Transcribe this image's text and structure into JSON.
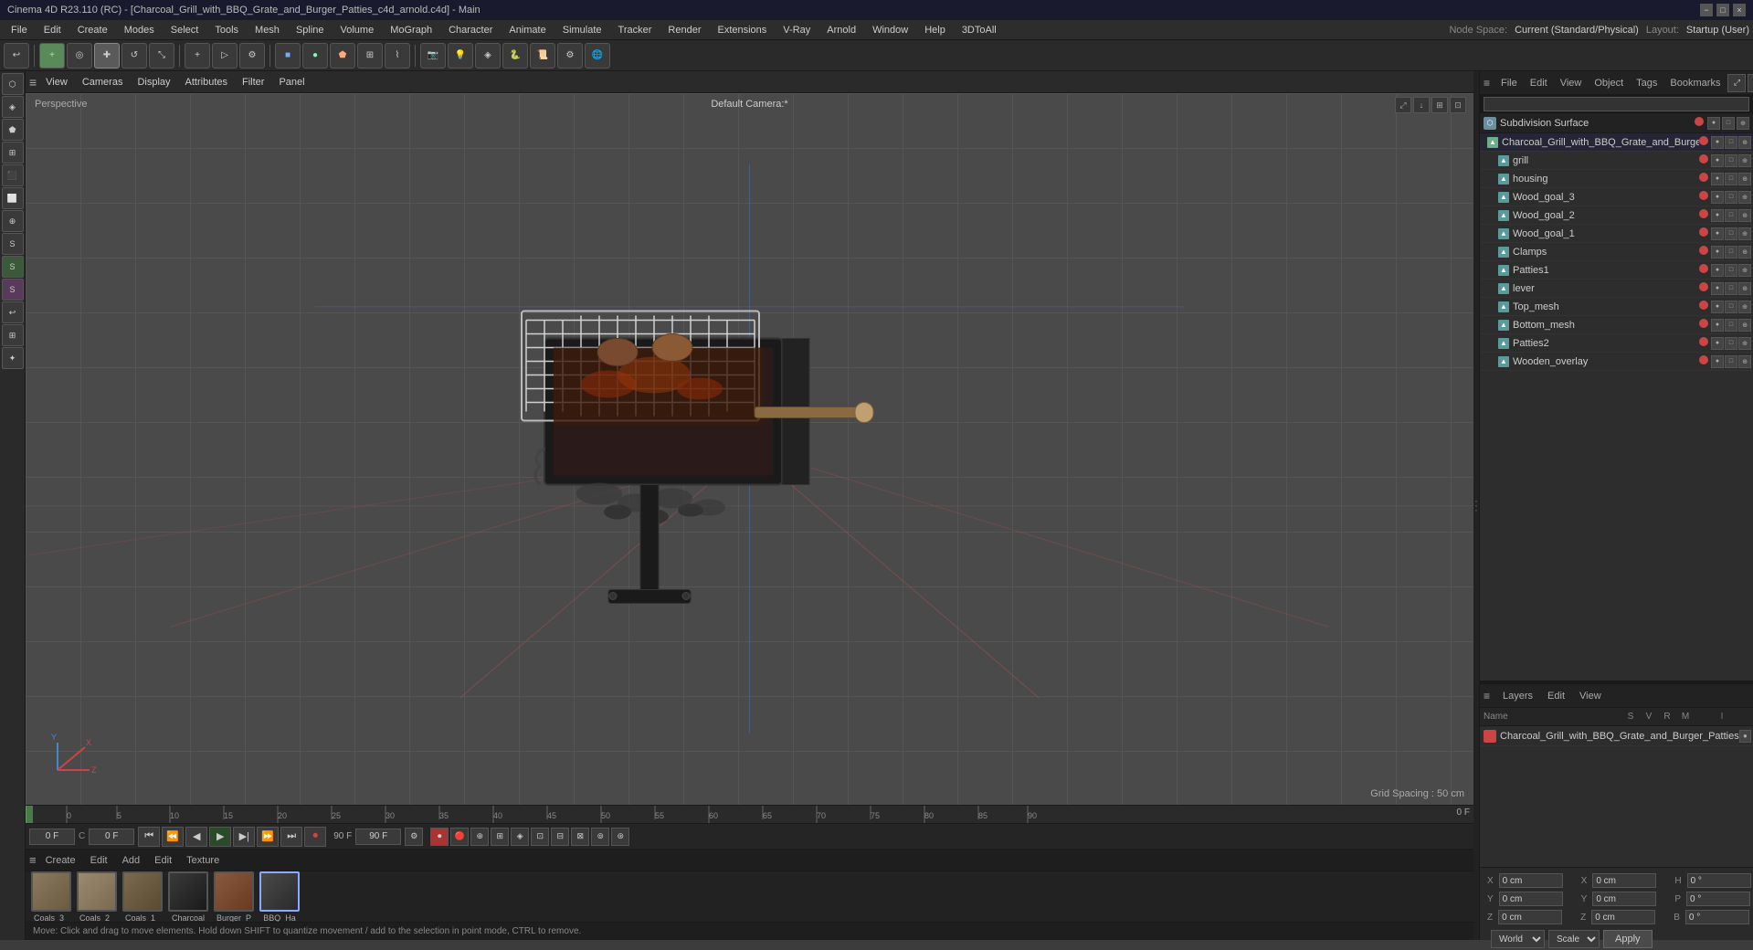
{
  "title_bar": {
    "text": "Cinema 4D R23.110 (RC) - [Charcoal_Grill_with_BBQ_Grate_and_Burger_Patties_c4d_arnold.c4d] - Main",
    "minimize": "−",
    "maximize": "□",
    "close": "×"
  },
  "menu_bar": {
    "items": [
      "File",
      "Edit",
      "Create",
      "Modes",
      "Select",
      "Tools",
      "Mesh",
      "Spline",
      "Volume",
      "MoGraph",
      "Character",
      "Animate",
      "Simulate",
      "Tracker",
      "Render",
      "Extensions",
      "V-Ray",
      "Arnold",
      "Window",
      "Help",
      "3DToAll"
    ],
    "node_space_label": "Node Space:",
    "node_space_value": "Current (Standard/Physical)",
    "layout_label": "Layout:",
    "layout_value": "Startup (User)"
  },
  "viewport": {
    "label": "Perspective",
    "camera": "Default Camera:*",
    "grid_spacing": "Grid Spacing : 50 cm",
    "menus": [
      "View",
      "Cameras",
      "Display",
      "Attributes",
      "Filter",
      "Panel"
    ]
  },
  "object_manager": {
    "menus": [
      "File",
      "Edit",
      "View",
      "Object",
      "Tags",
      "Bookmarks"
    ],
    "subdivision_surface": "Subdivision Surface",
    "root_object": "Charcoal_Grill_with_BBQ_Grate_and_Burger_Patties",
    "items": [
      {
        "name": "grill",
        "indent": 1,
        "color": "cyan"
      },
      {
        "name": "housing",
        "indent": 1,
        "color": "cyan"
      },
      {
        "name": "Wood_goal_3",
        "indent": 1,
        "color": "cyan"
      },
      {
        "name": "Wood_goal_2",
        "indent": 1,
        "color": "cyan"
      },
      {
        "name": "Wood_goal_1",
        "indent": 1,
        "color": "cyan"
      },
      {
        "name": "Clamps",
        "indent": 1,
        "color": "cyan"
      },
      {
        "name": "Patties1",
        "indent": 1,
        "color": "cyan"
      },
      {
        "name": "lever",
        "indent": 1,
        "color": "cyan"
      },
      {
        "name": "Top_mesh",
        "indent": 1,
        "color": "cyan"
      },
      {
        "name": "Bottom_mesh",
        "indent": 1,
        "color": "cyan"
      },
      {
        "name": "Patties2",
        "indent": 1,
        "color": "cyan"
      },
      {
        "name": "Wooden_overlay",
        "indent": 1,
        "color": "cyan"
      }
    ]
  },
  "layers_panel": {
    "toolbar_menus": [
      "Layers",
      "Edit",
      "View"
    ],
    "columns": {
      "name": "Name",
      "s": "S",
      "v": "V",
      "r": "R",
      "m": "M",
      "i": "I"
    },
    "items": [
      {
        "name": "Charcoal_Grill_with_BBQ_Grate_and_Burger_Patties",
        "color": "#cc4444"
      }
    ]
  },
  "material_bar": {
    "menus": [
      "Create",
      "Edit",
      "Add",
      "Edit",
      "Texture"
    ],
    "materials": [
      {
        "name": "Coals_3_",
        "color": "#8a7a60"
      },
      {
        "name": "Coals_2_",
        "color": "#9a8a70"
      },
      {
        "name": "Coals_1_",
        "color": "#7a6a50"
      },
      {
        "name": "Charcoal",
        "color": "#2a2a2a"
      },
      {
        "name": "Burger_P",
        "color": "#8a5a40"
      },
      {
        "name": "BBQ_Ha",
        "color": "#3a3a3a",
        "selected": true
      }
    ]
  },
  "coordinates": {
    "x_label": "X",
    "y_label": "Y",
    "z_label": "Z",
    "x_pos": "0 cm",
    "y_pos": "0 cm",
    "z_pos": "0 cm",
    "x2_label": "X",
    "y2_label": "Y",
    "z2_label": "Z",
    "x2_val": "0 cm",
    "y2_val": "0 cm",
    "z2_val": "0 cm",
    "h_label": "H",
    "p_label": "P",
    "b_label": "B",
    "h_val": "0°",
    "p_val": "0°",
    "b_val": "0°"
  },
  "bottom_dropdowns": {
    "world_label": "World",
    "scale_label": "Scale",
    "apply_label": "Apply"
  },
  "timeline": {
    "current_frame": "0 F",
    "end_frame": "90 F",
    "end_frame2": "90 F",
    "frame_input": "0 F",
    "frame_input2": "0 F"
  },
  "status_bar": {
    "text": "Move: Click and drag to move elements. Hold down SHIFT to quantize movement / add to the selection in point mode, CTRL to remove."
  },
  "icons": {
    "play": "▶",
    "pause": "⏸",
    "stop": "⏹",
    "skip_back": "⏮",
    "skip_fwd": "⏭",
    "step_back": "⏪",
    "step_fwd": "⏩",
    "record": "⏺",
    "key": "◆",
    "axis_x": "X",
    "axis_y": "Y",
    "axis_z": "Z"
  }
}
